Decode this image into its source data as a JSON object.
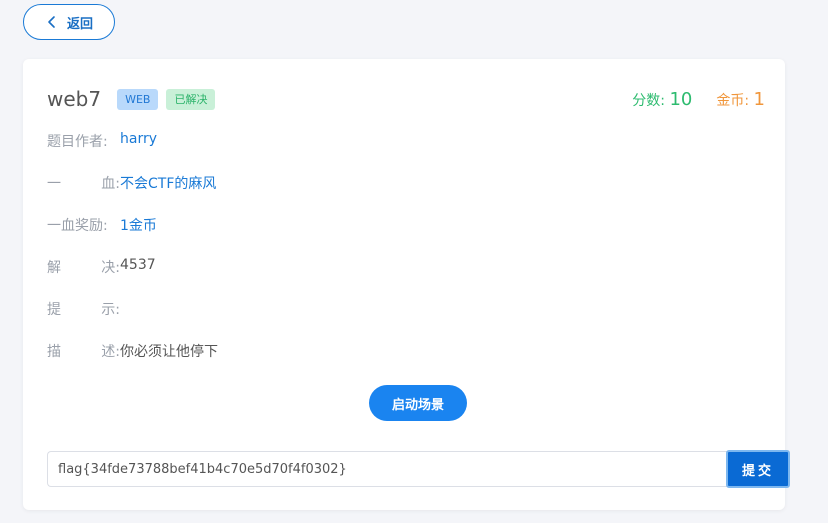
{
  "back_button": {
    "label": "返回",
    "icon": "chevron-left-icon"
  },
  "challenge": {
    "title": "web7",
    "category_badge": "WEB",
    "status_badge": "已解决",
    "score_label": "分数:",
    "score_value": "10",
    "coin_label": "金币:",
    "coin_value": "1"
  },
  "info": {
    "author_label": "题目作者:",
    "author_value": "harry",
    "first_blood_label_a": "一",
    "first_blood_label_b": "血:",
    "first_blood_value": "不会CTF的麻风",
    "first_blood_reward_label": "一血奖励:",
    "first_blood_reward_value": "1金币",
    "solves_label_a": "解",
    "solves_label_b": "决:",
    "solves_value": "4537",
    "hint_label_a": "提",
    "hint_label_b": "示:",
    "hint_value": "",
    "desc_label_a": "描",
    "desc_label_b": "述:",
    "desc_value": "你必须让他停下"
  },
  "start_button": {
    "label": "启动场景"
  },
  "flag_form": {
    "input_value": "flag{34fde73788bef41b4c70e5d70f4f0302}",
    "submit_label": "提交"
  },
  "colors": {
    "primary": "#1a84f0",
    "score_green": "#2dbb6f",
    "coin_orange": "#f0963b",
    "submit_blue": "#0a6ad4"
  }
}
